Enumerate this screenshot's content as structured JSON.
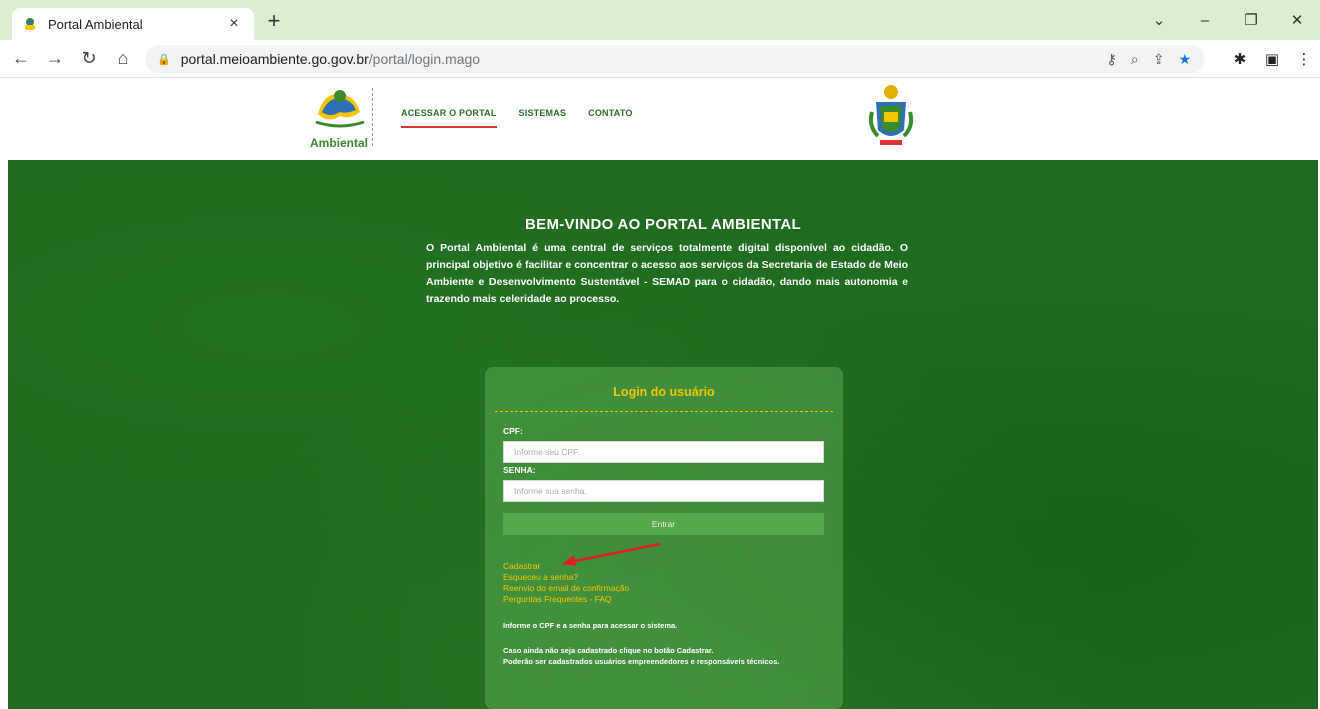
{
  "browser": {
    "tab_title": "Portal Ambiental",
    "tab_close": "×",
    "new_tab": "+",
    "url_host": "portal.meioambiente.go.gov.br",
    "url_path": "/portal/login.mago",
    "win_minimize": "–",
    "win_restore": "❐",
    "win_close": "✕",
    "win_dropdown": "⌄"
  },
  "site": {
    "logo_text": "Ambiental",
    "nav": [
      "ACESSAR O PORTAL",
      "SISTEMAS",
      "CONTATO"
    ]
  },
  "hero": {
    "title": "BEM-VINDO AO PORTAL AMBIENTAL",
    "text": "O Portal Ambiental é uma central de serviços totalmente digital disponível ao cidadão. O principal objetivo é facilitar e concentrar o acesso aos serviços da Secretaria de Estado de Meio Ambiente e Desenvolvimento Sustentável - SEMAD para o cidadão, dando mais autonomia e trazendo mais celeridade ao processo."
  },
  "login": {
    "title": "Login do usuário",
    "cpf_label": "CPF:",
    "cpf_placeholder": "Informe seu CPF.",
    "senha_label": "SENHA:",
    "senha_placeholder": "Informe sua senha.",
    "enter_label": "Entrar",
    "links": [
      "Cadastrar",
      "Esqueceu a senha?",
      "Reenvio do email de confirmação",
      "Perguntas Frequentes - FAQ"
    ],
    "info_1": "Informe o CPF e a senha para acessar o sistema.",
    "info_2": "Caso ainda não seja cadastrado clique no botão Cadastrar.",
    "info_3": "Poderão ser cadastrados usuários empreendedores e responsáveis técnicos."
  },
  "colors": {
    "tabbar": "#dcedd2",
    "hero_green": "#1f6b1f",
    "accent_yellow": "#f4c600",
    "button_green": "#57a84a",
    "annotation_arrow": "#e02020"
  }
}
